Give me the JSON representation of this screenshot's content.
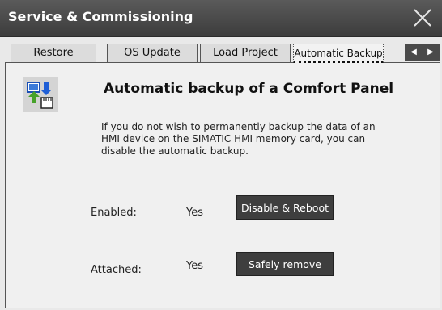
{
  "window": {
    "title": "Service & Commissioning"
  },
  "tabs": [
    {
      "label": "Restore"
    },
    {
      "label": "OS Update"
    },
    {
      "label": "Load Project"
    },
    {
      "label": "Automatic Backup",
      "active": true
    }
  ],
  "tab_scroll": {
    "left": "◀",
    "right": "▶"
  },
  "content": {
    "heading": "Automatic backup of a Comfort Panel",
    "description": "If you do not wish to permanently backup the data of an HMI device on the SIMATIC HMI memory card, you can disable the automatic backup.",
    "rows": [
      {
        "label": "Enabled:",
        "value": "Yes",
        "button": "Disable & Reboot"
      },
      {
        "label": "Attached:",
        "value": "Yes",
        "button": "Safely remove"
      }
    ]
  },
  "colors": {
    "titlebar": "#4a4a4a",
    "button": "#3e3e3e",
    "panel": "#f0f0f0"
  },
  "icons": {
    "close": "close-icon",
    "app": "backup-icon"
  }
}
